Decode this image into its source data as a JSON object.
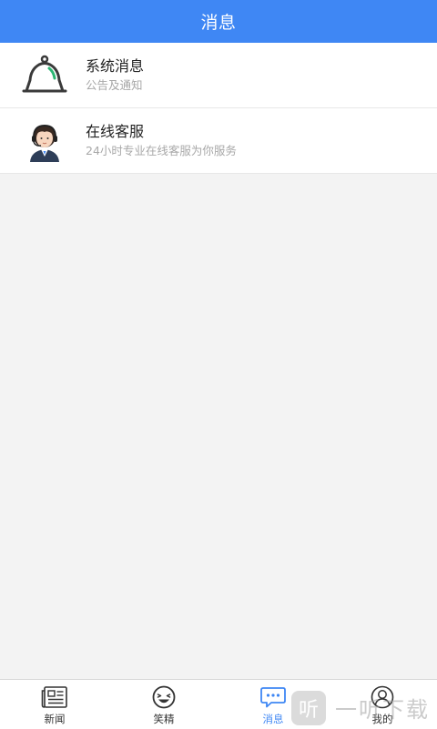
{
  "header": {
    "title": "消息"
  },
  "list": [
    {
      "title": "系统消息",
      "subtitle": "公告及通知",
      "icon": "bell-icon"
    },
    {
      "title": "在线客服",
      "subtitle": "24小时专业在线客服为你服务",
      "icon": "customer-service-avatar-icon"
    }
  ],
  "tabbar": {
    "tabs": [
      {
        "label": "新闻",
        "icon": "newspaper-icon",
        "active": false
      },
      {
        "label": "笑精",
        "icon": "laugh-face-icon",
        "active": false
      },
      {
        "label": "消息",
        "icon": "chat-bubble-icon",
        "active": true
      },
      {
        "label": "我的",
        "icon": "user-icon",
        "active": false
      }
    ]
  },
  "watermark": {
    "logo_text": "听",
    "text": "一听下载"
  },
  "colors": {
    "accent": "#3f87f4",
    "background": "#f3f3f3",
    "bell_stroke": "#3a3a3a",
    "bell_highlight": "#2bb673"
  }
}
